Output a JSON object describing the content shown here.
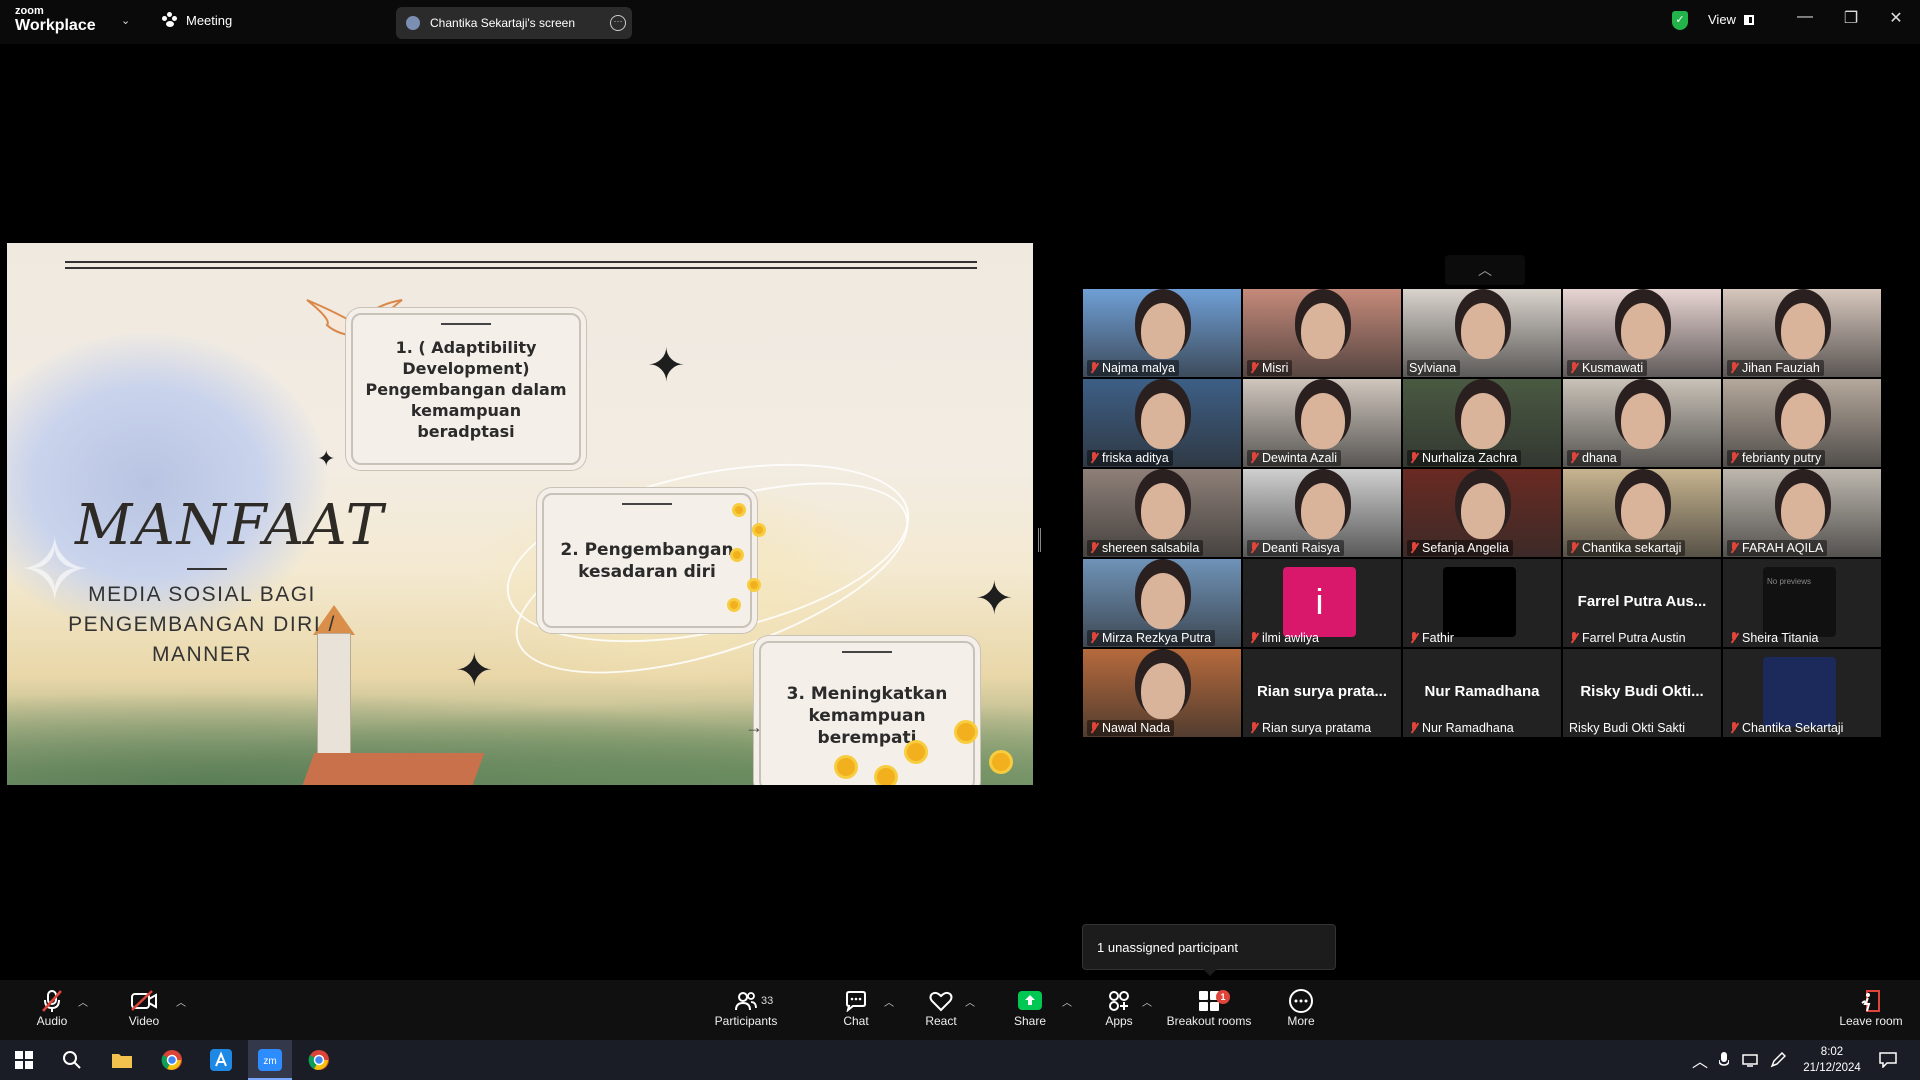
{
  "titlebar": {
    "logo_small": "zoom",
    "logo_big": "Workplace",
    "meeting_label": "Meeting",
    "screen_share_label": "Chantika Sekartaji's screen",
    "view_label": "View"
  },
  "slide": {
    "title": "MANFAAT",
    "subtitle": "MEDIA SOSIAL BAGI PENGEMBANGAN DIRI / MANNER",
    "points": [
      "1. ( Adaptibility Development) Pengembangan dalam kemampuan beradptasi",
      "2. Pengembangan kesadaran diri",
      "3. Meningkatkan kemampuan berempati"
    ]
  },
  "gallery": {
    "participants": [
      {
        "name": "Najma malya",
        "video": true,
        "muted": true,
        "bg": "#6f9fd6"
      },
      {
        "name": "Misri",
        "video": true,
        "muted": true,
        "bg": "#c58a7a"
      },
      {
        "name": "Sylviana",
        "video": true,
        "muted": false,
        "bg": "#d9d3cc"
      },
      {
        "name": "Kusmawati",
        "video": true,
        "muted": true,
        "bg": "#e8d5d3"
      },
      {
        "name": "Jihan Fauziah",
        "video": true,
        "muted": true,
        "bg": "#d7c7bd"
      },
      {
        "name": "friska aditya",
        "video": true,
        "muted": true,
        "bg": "#3d5f86"
      },
      {
        "name": "Dewinta Azali",
        "video": true,
        "muted": true,
        "bg": "#cfc6bd"
      },
      {
        "name": "Nurhaliza Zachra",
        "video": true,
        "muted": true,
        "bg": "#4a5a42"
      },
      {
        "name": "dhana",
        "video": true,
        "muted": true,
        "bg": "#c9c2b8"
      },
      {
        "name": "febrianty putry",
        "video": true,
        "muted": true,
        "bg": "#b5a89c"
      },
      {
        "name": "shereen salsabila",
        "video": true,
        "muted": true,
        "bg": "#8e8078"
      },
      {
        "name": "Deanti Raisya",
        "video": true,
        "muted": true,
        "bg": "#cfcfcf"
      },
      {
        "name": "Sefanja Angelia",
        "video": true,
        "muted": true,
        "bg": "#6a2a22"
      },
      {
        "name": "Chantika sekartaji",
        "video": true,
        "muted": true,
        "bg": "#c7b48f"
      },
      {
        "name": "FARAH AQILA",
        "video": true,
        "muted": true,
        "bg": "#bdb7ae"
      },
      {
        "name": "Mirza Rezkya Putra",
        "video": true,
        "muted": true,
        "bg": "#6f93b8"
      },
      {
        "name": "ilmi awliya",
        "video": false,
        "muted": true,
        "avatar_letter": "i",
        "avatar_color": "#d9186b"
      },
      {
        "name": "Fathir",
        "video": false,
        "muted": true,
        "avatar_color": "#000000"
      },
      {
        "name": "Farrel Putra Austin",
        "video": false,
        "muted": true,
        "big_name": "Farrel Putra Aus..."
      },
      {
        "name": "Sheira Titania",
        "video": false,
        "muted": true,
        "avatar_color": "#111111",
        "avatar_text": "No previews"
      },
      {
        "name": "Nawal Nada",
        "video": true,
        "muted": true,
        "bg": "#b66a3c"
      },
      {
        "name": "Rian surya pratama",
        "video": false,
        "muted": true,
        "big_name": "Rian surya prata..."
      },
      {
        "name": "Nur Ramadhana",
        "video": false,
        "muted": true,
        "big_name": "Nur Ramadhana"
      },
      {
        "name": "Risky Budi Okti Sakti",
        "video": false,
        "muted": false,
        "big_name": "Risky Budi Okti..."
      },
      {
        "name": "Chantika Sekartaji",
        "video": false,
        "muted": true,
        "avatar_color": "#1b2a5a"
      }
    ]
  },
  "unassigned_notice": "1 unassigned participant",
  "toolbar": {
    "audio": "Audio",
    "video": "Video",
    "participants": "Participants",
    "participants_count": "33",
    "chat": "Chat",
    "react": "React",
    "share": "Share",
    "apps": "Apps",
    "breakout": "Breakout rooms",
    "breakout_badge": "1",
    "more": "More",
    "leave": "Leave room"
  },
  "taskbar": {
    "time": "8:02",
    "date": "21/12/2024"
  },
  "colors": {
    "share_green": "#00c853",
    "mute_red": "#e0453c",
    "shield_green": "#22b34a"
  }
}
